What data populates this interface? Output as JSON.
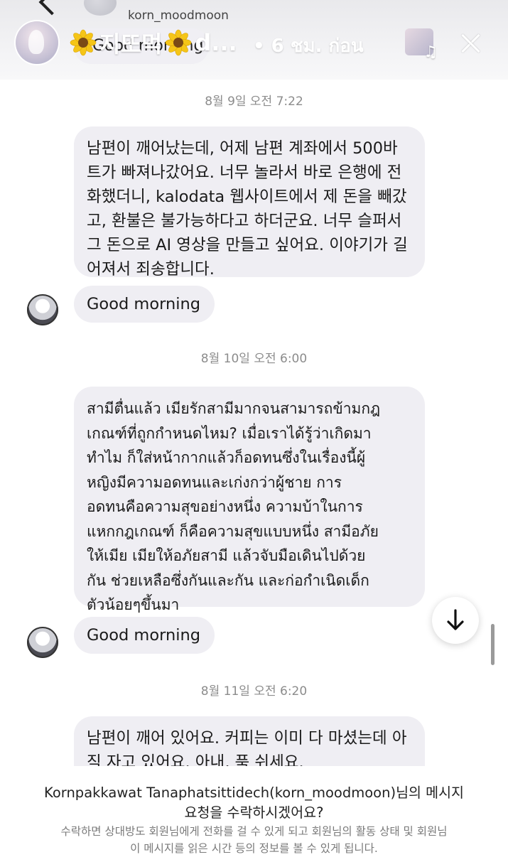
{
  "header": {
    "username": "korn_moodmoon",
    "story_title": "지또먹",
    "story_title_suffix": "d...",
    "story_time": "• 6 ชม. ก่อน",
    "peek_message": "Good morning",
    "icons": [
      "back-chevron-icon",
      "sunflower-icon",
      "music-note-icon",
      "close-icon"
    ]
  },
  "messages": [
    {
      "type": "timestamp",
      "text": "8월 9일 오전 7:22"
    },
    {
      "type": "bubble",
      "lines": [
        "남편이 깨어났는데, 어제 남편 계좌에서 500바",
        "트가 빠져나갔어요. 너무 놀라서 바로 은행에 전",
        "화했더니, kalodata 웹사이트에서 제 돈을 빼갔",
        "고, 환불은 불가능하다고 하더군요. 너무 슬퍼서",
        "그 돈으로 AI 영상을 만들고 싶어요. 이야기가 길",
        "어져서 죄송합니다."
      ]
    },
    {
      "type": "bubble",
      "text": "Good morning"
    },
    {
      "type": "timestamp",
      "text": "8월 10일 오전 6:00"
    },
    {
      "type": "bubble",
      "lines": [
        "สามีตื่นแล้ว เมียรักสามีมากจนสามารถข้ามกฎ",
        "เกณฑ์ที่ถูกกำหนดไหม? เมื่อเราได้รู้ว่าเกิดมา",
        "ทำไม ก็ใส่หน้ากากแล้วก็อดทนซึ่งในเรื่องนี้ผู้",
        "หญิงมีความอดทนและเก่งกว่าผู้ชาย การ",
        "อดทนคือความสุขอย่างหนึ่ง ความบ้าในการ",
        "แหกกฎเกณฑ์ ก็คือความสุขแบบหนึ่ง สามีอภัย",
        "ให้เมีย เมียให้อภัยสามี แล้วจับมือเดินไปด้วย",
        "กัน ช่วยเหลือซึ่งกันและกัน และก่อกำเนิดเด็ก",
        "ตัวน้อยๆขึ้นมา"
      ]
    },
    {
      "type": "bubble",
      "text": "Good morning"
    },
    {
      "type": "timestamp",
      "text": "8월 11일 오전 6:20"
    },
    {
      "type": "bubble",
      "lines": [
        "남편이 깨어 있어요. 커피는 이미 다 마셨는데 아",
        "직 자고 있어요. 아내, 푹 쉬세요."
      ]
    }
  ],
  "request": {
    "title_line1": "Kornpakkawat Tanaphatsittidech(korn_moodmoon)님의 메시지",
    "title_line2": "요청을 수락하시겠어요?",
    "desc_line1": "수락하면 상대방도 회원님에게 전화를 걸 수 있게 되고 회원님의 활동 상태 및 회원님",
    "desc_line2": "이 메시지를 읽은 시간 등의 정보를 볼 수 있게 됩니다."
  },
  "colors": {
    "bubble_bg": "#efeef3",
    "timestamp": "#8c8c8c",
    "text": "#1a1a1a"
  }
}
